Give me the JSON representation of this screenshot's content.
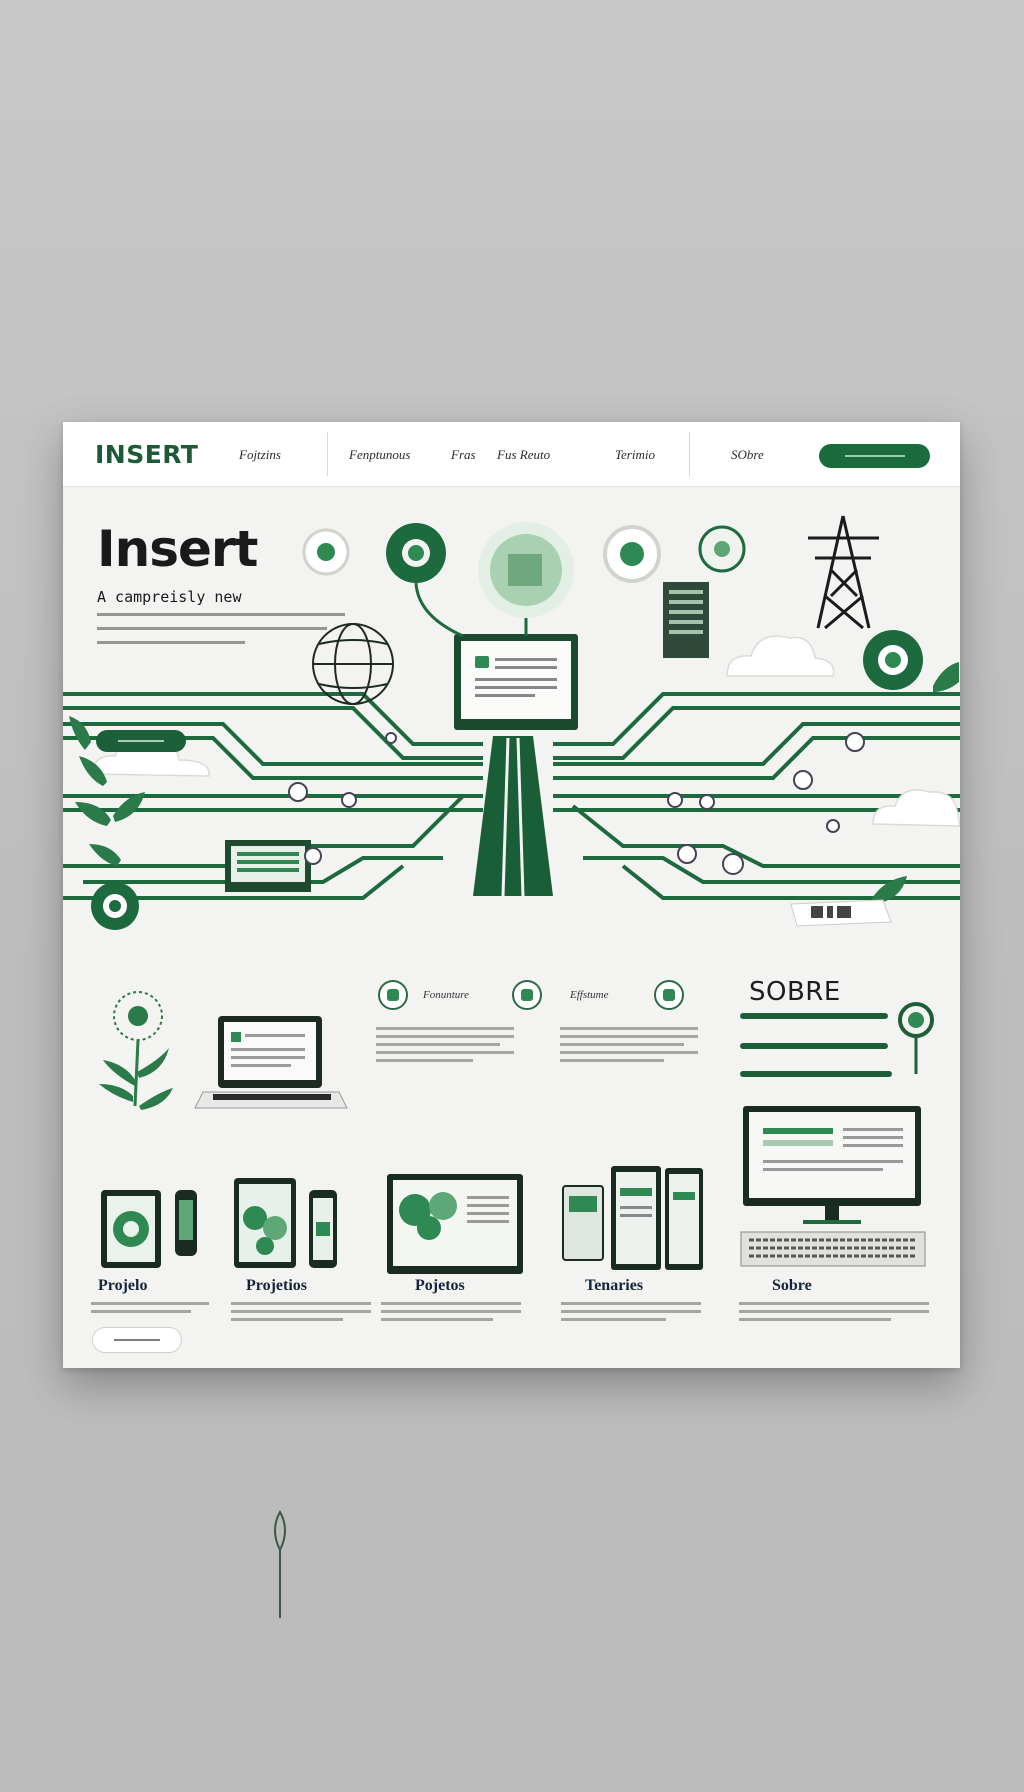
{
  "brand": {
    "logo": "INSERT",
    "accent": "#1c6b3d",
    "accent_light": "#2e8a52"
  },
  "nav": {
    "links": [
      "Fojtzins",
      "Fenptunous",
      "Fras",
      "Fus Reuto",
      "Terimio",
      "SObre"
    ]
  },
  "hero": {
    "title": "Insert",
    "subtitle": "A campreisly new"
  },
  "features": [
    {
      "label": "Fonunture",
      "icon": "leaf-badge-icon"
    },
    {
      "label": "Effstume",
      "icon": "bucket-icon"
    },
    {
      "label": "",
      "icon": "shield-icon"
    }
  ],
  "sobre": {
    "title": "SOBRE"
  },
  "columns": [
    {
      "title": "Projelo"
    },
    {
      "title": "Projetios"
    },
    {
      "title": "Pojetos"
    },
    {
      "title": "Tenaries"
    },
    {
      "title": "Sobre"
    }
  ]
}
